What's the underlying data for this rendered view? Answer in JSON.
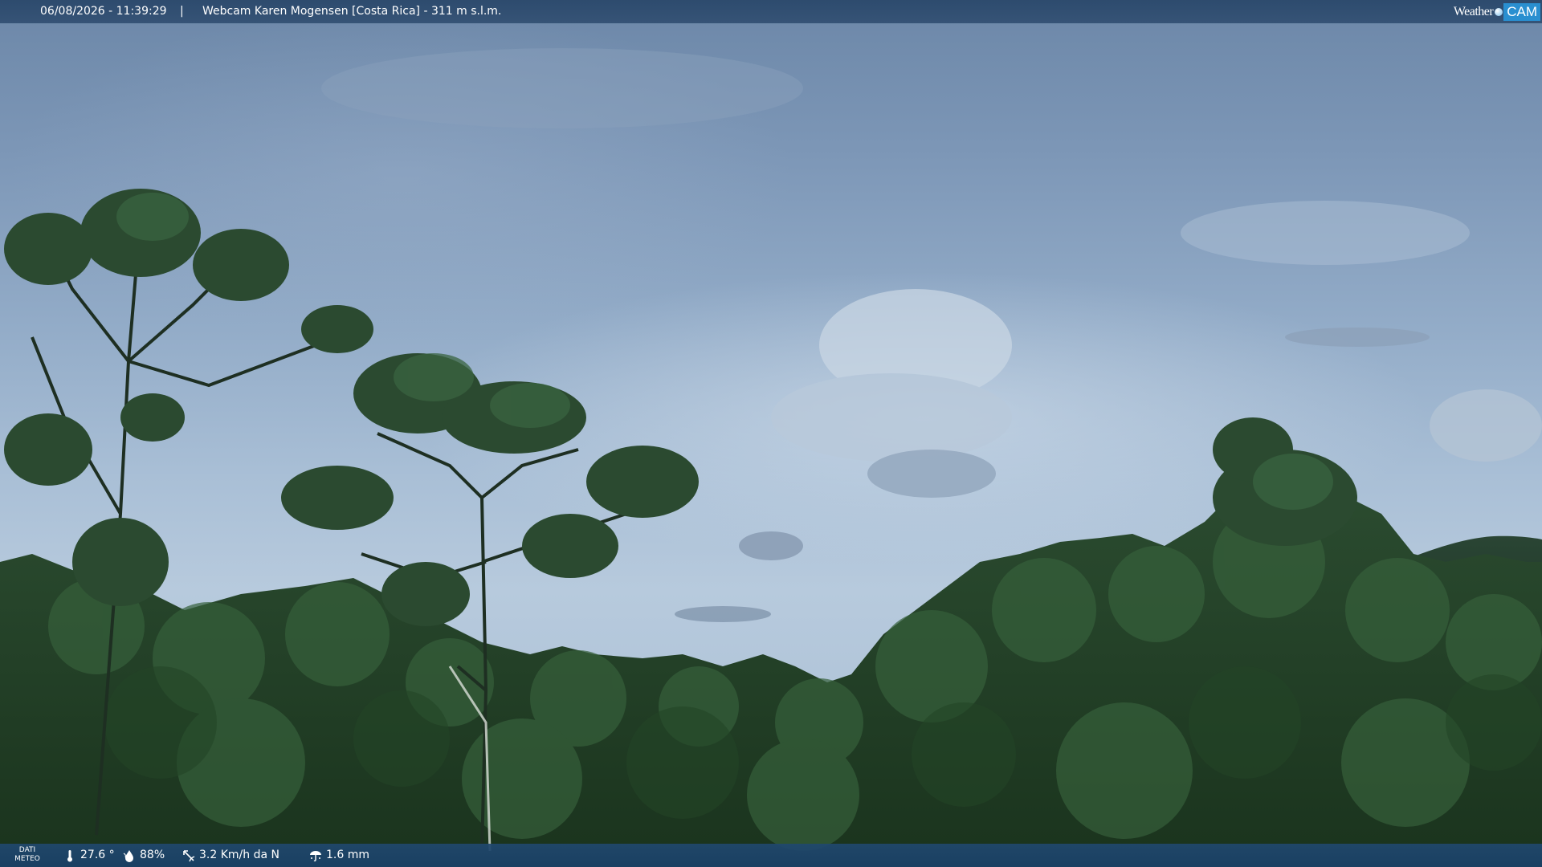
{
  "topbar": {
    "datetime": "06/08/2026 - 11:39:29",
    "separator": "|",
    "camera_title": "Webcam Karen Mogensen [Costa Rica] - 311 m s.l.m."
  },
  "brand": {
    "weather": "Weather",
    "cam": "CAM"
  },
  "weather_bar": {
    "label_line1": "DATI",
    "label_line2": "METEO",
    "temperature": "27.6 °",
    "humidity": "88%",
    "wind": "3.2 Km/h da N",
    "rain": "1.6 mm"
  },
  "icons": {
    "temperature": "thermometer-icon",
    "humidity": "humidity-drop-icon",
    "wind": "wind-vane-icon",
    "rain": "rain-gauge-icon",
    "brand_dot": "globe-dot-icon"
  },
  "colors": {
    "topbar": "#28466a",
    "bottombar": "#1f4670",
    "brand_cam": "#2a8fd0",
    "foliage_dark": "#1e3a22",
    "foliage_mid": "#2f5533"
  }
}
